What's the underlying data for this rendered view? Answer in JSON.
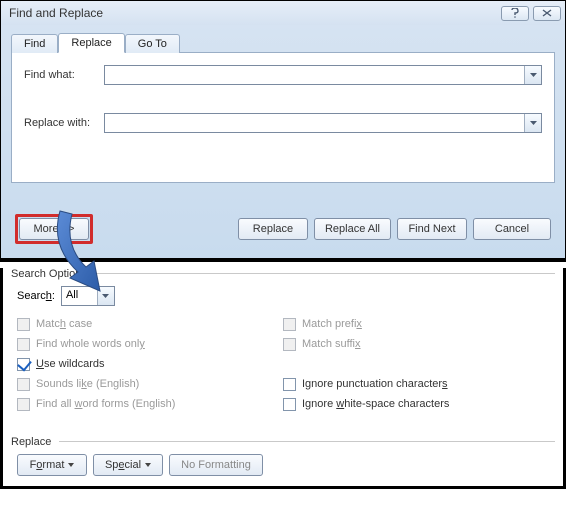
{
  "dialog": {
    "title": "Find and Replace",
    "tabs": {
      "find": "Find",
      "replace": "Replace",
      "goto": "Go To"
    },
    "find_label": "Find what:",
    "replace_label": "Replace with:",
    "find_value": "",
    "replace_value": "",
    "more_btn": "More >>",
    "buttons": {
      "replace": "Replace",
      "replace_all": "Replace All",
      "find_next": "Find Next",
      "cancel": "Cancel"
    }
  },
  "search_options": {
    "group_title": "Search Options",
    "search_label": "Search:",
    "search_value": "All",
    "left": {
      "match_case": "Match case",
      "whole_words": "Find whole words only",
      "wildcards": "Use wildcards",
      "sounds_like": "Sounds like (English)",
      "word_forms": "Find all word forms (English)"
    },
    "right": {
      "match_prefix": "Match prefix",
      "match_suffix": "Match suffix",
      "ignore_punct": "Ignore punctuation characters",
      "ignore_ws": "Ignore white-space characters"
    }
  },
  "replace_group": {
    "title": "Replace",
    "format_btn": "Format",
    "special_btn": "Special",
    "no_formatting_btn": "No Formatting"
  }
}
